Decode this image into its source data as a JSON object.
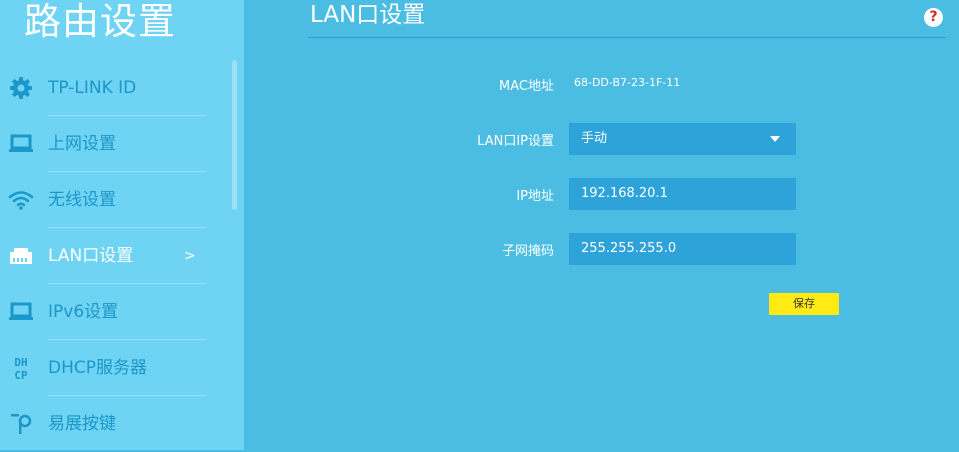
{
  "sidebar": {
    "title": "路由设置",
    "items": [
      {
        "label": "TP-LINK ID",
        "icon": "gear-icon"
      },
      {
        "label": "上网设置",
        "icon": "laptop-icon"
      },
      {
        "label": "无线设置",
        "icon": "wifi-icon"
      },
      {
        "label": "LAN口设置",
        "icon": "lan-port-icon",
        "active": true,
        "arrow": ">"
      },
      {
        "label": "IPv6设置",
        "icon": "laptop-icon"
      },
      {
        "label": "DHCP服务器",
        "icon": "dhcp-icon",
        "icon_text": [
          "DH",
          "CP"
        ]
      },
      {
        "label": "易展按键",
        "icon": "easy-mesh-icon"
      }
    ]
  },
  "main": {
    "title": "LAN口设置",
    "help": "?",
    "mac": {
      "label": "MAC地址",
      "value": "68-DD-B7-23-1F-11"
    },
    "lan_ip_mode": {
      "label": "LAN口IP设置",
      "value": "手动"
    },
    "ip": {
      "label": "IP地址",
      "value": "192.168.20.1"
    },
    "subnet": {
      "label": "子网掩码",
      "value": "255.255.255.0"
    },
    "save_label": "保存"
  },
  "colors": {
    "sidebar_bg": "#6fd3f3",
    "main_bg": "#4bbde3",
    "nav_text": "#1b97c9",
    "field_bg": "#2ea3d9",
    "save_bg": "#ffeb13"
  }
}
